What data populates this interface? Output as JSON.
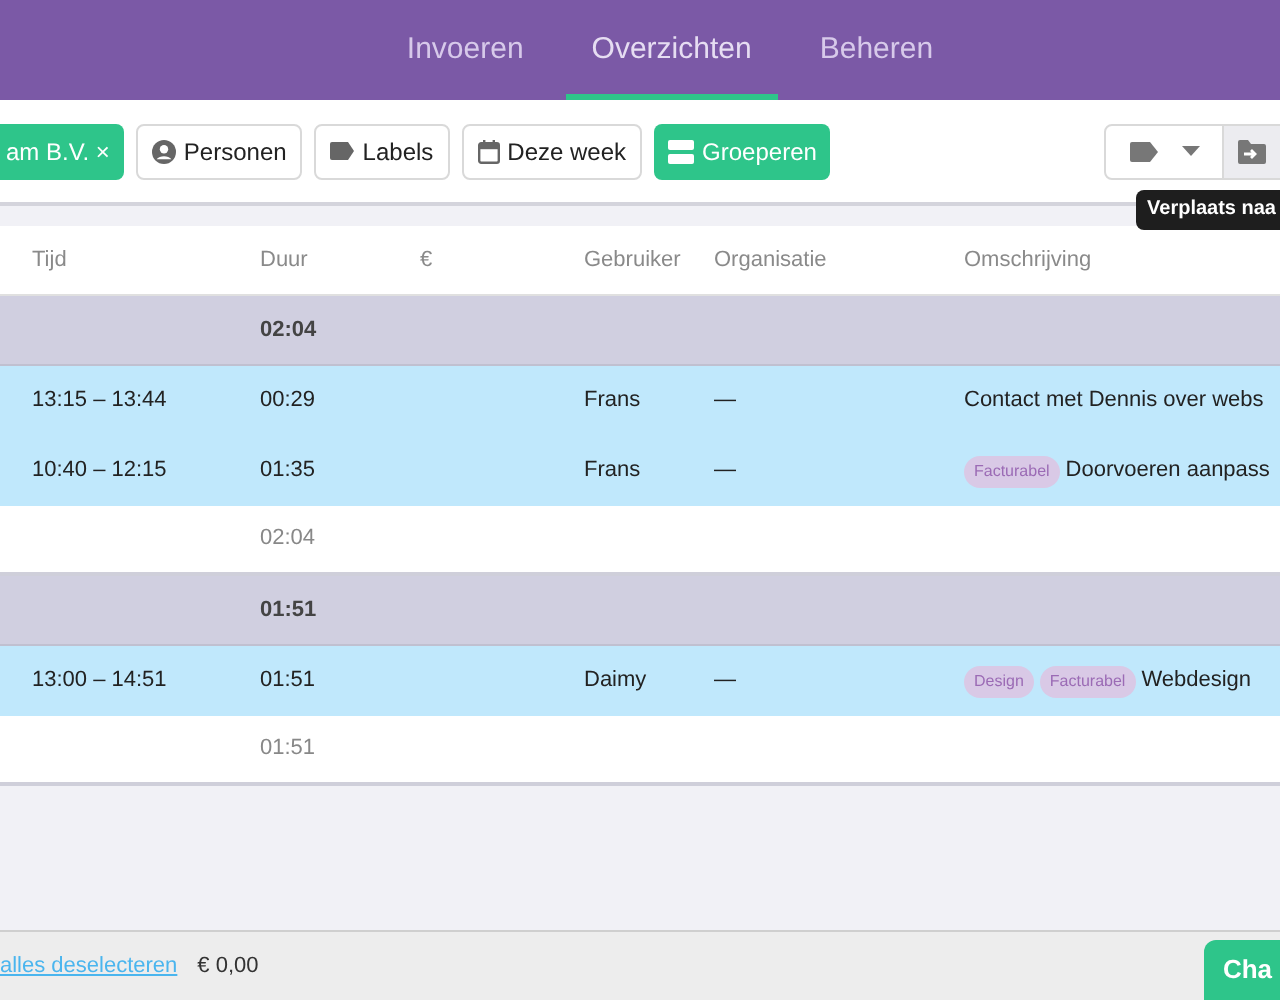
{
  "nav": {
    "tabs": [
      {
        "label": "Invoeren",
        "selected": false
      },
      {
        "label": "Overzichten",
        "selected": true
      },
      {
        "label": "Beheren",
        "selected": false
      }
    ]
  },
  "toolbar": {
    "filters": [
      {
        "kind": "active",
        "label": "am B.V. ×"
      },
      {
        "kind": "person",
        "label": "Personen"
      },
      {
        "kind": "tag",
        "label": "Labels"
      },
      {
        "kind": "calendar",
        "label": "Deze week"
      },
      {
        "kind": "group",
        "label": "Groeperen"
      }
    ],
    "tooltip": "Verplaats naa"
  },
  "table": {
    "columns": [
      "Tijd",
      "Duur",
      "€",
      "Gebruiker",
      "Organisatie",
      "Omschrijving"
    ],
    "groups": [
      {
        "total": "02:04",
        "subtotal": "02:04",
        "rows": [
          {
            "tijd": "13:15 – 13:44",
            "duur": "00:29",
            "gebruiker": "Frans",
            "organisatie": "—",
            "labels": [],
            "omschrijving": "Contact met Dennis over webs",
            "selected": true
          },
          {
            "tijd": "10:40 – 12:15",
            "duur": "01:35",
            "gebruiker": "Frans",
            "organisatie": "—",
            "labels": [
              "Facturabel"
            ],
            "omschrijving": "Doorvoeren aanpass",
            "selected": true
          }
        ]
      },
      {
        "total": "01:51",
        "subtotal": "01:51",
        "rows": [
          {
            "tijd": "13:00 – 14:51",
            "duur": "01:51",
            "gebruiker": "Daimy",
            "organisatie": "—",
            "labels": [
              "Design",
              "Facturabel"
            ],
            "omschrijving": "Webdesign",
            "selected": true
          }
        ]
      }
    ]
  },
  "footer": {
    "link": "alles deselecteren",
    "amount": "€ 0,00",
    "button": "Cha"
  }
}
